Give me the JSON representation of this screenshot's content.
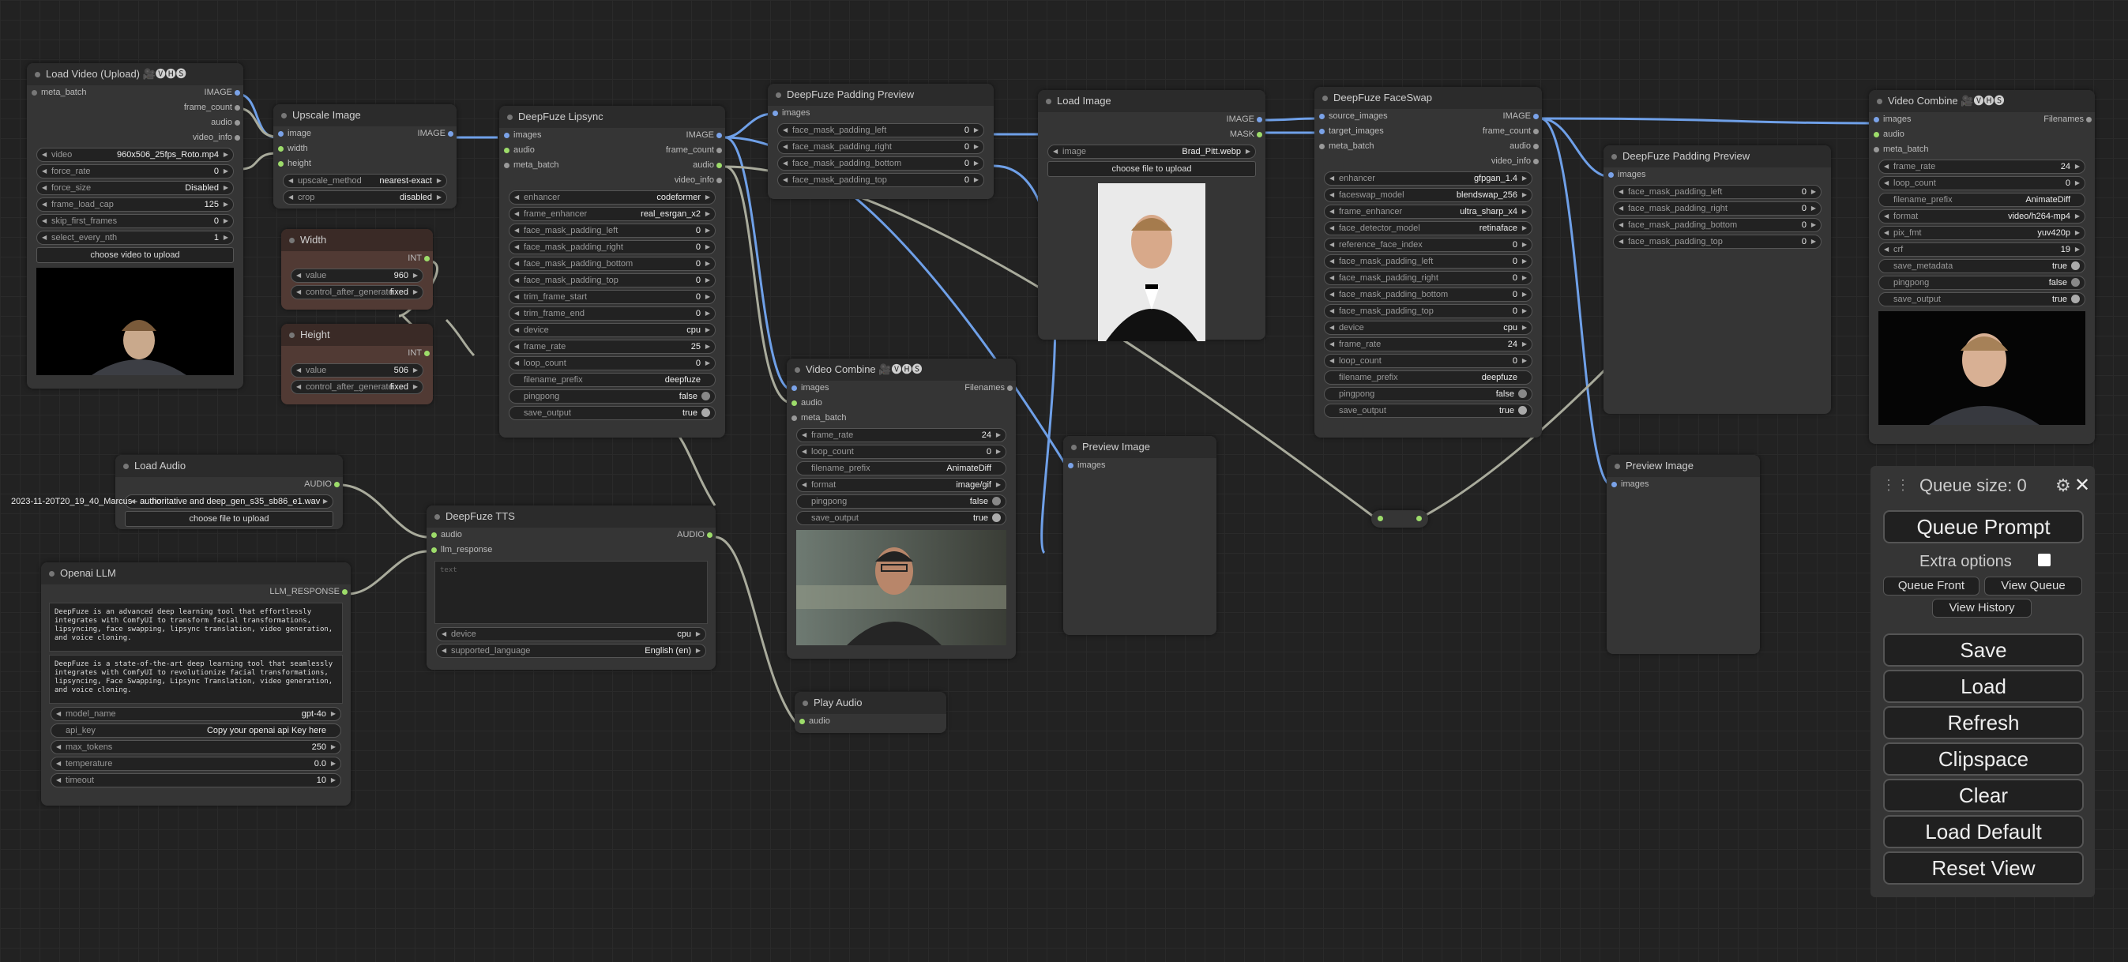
{
  "app": {
    "name": "ComfyUI"
  },
  "nodes": {
    "load_video": {
      "title": "Load Video (Upload) 🎥🅥🅗🅢",
      "inputs": [
        "meta_batch"
      ],
      "outputs": [
        "IMAGE",
        "frame_count",
        "audio",
        "video_info"
      ],
      "widgets": [
        {
          "label": "video",
          "value": "960x506_25fps_Roto.mp4"
        },
        {
          "label": "force_rate",
          "value": "0"
        },
        {
          "label": "force_size",
          "value": "Disabled"
        },
        {
          "label": "frame_load_cap",
          "value": "125"
        },
        {
          "label": "skip_first_frames",
          "value": "0"
        },
        {
          "label": "select_every_nth",
          "value": "1"
        }
      ],
      "upload_label": "choose video to upload"
    },
    "upscale_image": {
      "title": "Upscale Image",
      "inputs": [
        "image",
        "width",
        "height"
      ],
      "outputs": [
        "IMAGE"
      ],
      "widgets": [
        {
          "label": "upscale_method",
          "value": "nearest-exact"
        },
        {
          "label": "crop",
          "value": "disabled"
        }
      ]
    },
    "width": {
      "title": "Width",
      "output": "INT",
      "widgets": [
        {
          "label": "value",
          "value": "960"
        },
        {
          "label": "control_after_generate",
          "value": "fixed"
        }
      ]
    },
    "height": {
      "title": "Height",
      "output": "INT",
      "widgets": [
        {
          "label": "value",
          "value": "506"
        },
        {
          "label": "control_after_generate",
          "value": "fixed"
        }
      ]
    },
    "lipsync": {
      "title": "DeepFuze Lipsync",
      "inputs": [
        "images",
        "audio",
        "meta_batch"
      ],
      "outputs": [
        "IMAGE",
        "frame_count",
        "audio",
        "video_info"
      ],
      "widgets": [
        {
          "label": "enhancer",
          "value": "codeformer"
        },
        {
          "label": "frame_enhancer",
          "value": "real_esrgan_x2"
        },
        {
          "label": "face_mask_padding_left",
          "value": "0"
        },
        {
          "label": "face_mask_padding_right",
          "value": "0"
        },
        {
          "label": "face_mask_padding_bottom",
          "value": "0"
        },
        {
          "label": "face_mask_padding_top",
          "value": "0"
        },
        {
          "label": "trim_frame_start",
          "value": "0"
        },
        {
          "label": "trim_frame_end",
          "value": "0"
        },
        {
          "label": "device",
          "value": "cpu"
        },
        {
          "label": "frame_rate",
          "value": "25"
        },
        {
          "label": "loop_count",
          "value": "0"
        }
      ],
      "text_widgets": [
        {
          "label": "filename_prefix",
          "value": "deepfuze"
        }
      ],
      "toggles": [
        {
          "label": "pingpong",
          "value": "false"
        },
        {
          "label": "save_output",
          "value": "true"
        }
      ]
    },
    "padding_preview1": {
      "title": "DeepFuze Padding Preview",
      "inputs": [
        "images"
      ],
      "widgets": [
        {
          "label": "face_mask_padding_left",
          "value": "0"
        },
        {
          "label": "face_mask_padding_right",
          "value": "0"
        },
        {
          "label": "face_mask_padding_bottom",
          "value": "0"
        },
        {
          "label": "face_mask_padding_top",
          "value": "0"
        }
      ]
    },
    "load_image": {
      "title": "Load Image",
      "outputs": [
        "IMAGE",
        "MASK"
      ],
      "widgets": [
        {
          "label": "image",
          "value": "Brad_Pitt.webp"
        }
      ],
      "upload_label": "choose file to upload"
    },
    "faceswap": {
      "title": "DeepFuze FaceSwap",
      "inputs": [
        "source_images",
        "target_images",
        "meta_batch"
      ],
      "outputs": [
        "IMAGE",
        "frame_count",
        "audio",
        "video_info"
      ],
      "widgets": [
        {
          "label": "enhancer",
          "value": "gfpgan_1.4"
        },
        {
          "label": "faceswap_model",
          "value": "blendswap_256"
        },
        {
          "label": "frame_enhancer",
          "value": "ultra_sharp_x4"
        },
        {
          "label": "face_detector_model",
          "value": "retinaface"
        },
        {
          "label": "reference_face_index",
          "value": "0"
        },
        {
          "label": "face_mask_padding_left",
          "value": "0"
        },
        {
          "label": "face_mask_padding_right",
          "value": "0"
        },
        {
          "label": "face_mask_padding_bottom",
          "value": "0"
        },
        {
          "label": "face_mask_padding_top",
          "value": "0"
        },
        {
          "label": "device",
          "value": "cpu"
        },
        {
          "label": "frame_rate",
          "value": "24"
        },
        {
          "label": "loop_count",
          "value": "0"
        }
      ],
      "text_widgets": [
        {
          "label": "filename_prefix",
          "value": "deepfuze"
        }
      ],
      "toggles": [
        {
          "label": "pingpong",
          "value": "false"
        },
        {
          "label": "save_output",
          "value": "true"
        }
      ]
    },
    "padding_preview2": {
      "title": "DeepFuze Padding Preview",
      "inputs": [
        "images"
      ],
      "widgets": [
        {
          "label": "face_mask_padding_left",
          "value": "0"
        },
        {
          "label": "face_mask_padding_right",
          "value": "0"
        },
        {
          "label": "face_mask_padding_bottom",
          "value": "0"
        },
        {
          "label": "face_mask_padding_top",
          "value": "0"
        }
      ]
    },
    "video_combine1": {
      "title": "Video Combine 🎥🅥🅗🅢",
      "inputs": [
        "images",
        "audio",
        "meta_batch"
      ],
      "outputs": [
        "Filenames"
      ],
      "widgets": [
        {
          "label": "frame_rate",
          "value": "24"
        },
        {
          "label": "loop_count",
          "value": "0"
        },
        {
          "label": "format",
          "value": "image/gif"
        }
      ],
      "text_widgets": [
        {
          "label": "filename_prefix",
          "value": "AnimateDiff"
        }
      ],
      "toggles": [
        {
          "label": "pingpong",
          "value": "false"
        },
        {
          "label": "save_output",
          "value": "true"
        }
      ]
    },
    "video_combine2": {
      "title": "Video Combine 🎥🅥🅗🅢",
      "inputs": [
        "images",
        "audio",
        "meta_batch"
      ],
      "outputs": [
        "Filenames"
      ],
      "widgets": [
        {
          "label": "frame_rate",
          "value": "24"
        },
        {
          "label": "loop_count",
          "value": "0"
        },
        {
          "label": "format",
          "value": "video/h264-mp4"
        },
        {
          "label": "pix_fmt",
          "value": "yuv420p"
        },
        {
          "label": "crf",
          "value": "19"
        }
      ],
      "text_widgets": [
        {
          "label": "filename_prefix",
          "value": "AnimateDiff"
        }
      ],
      "toggles": [
        {
          "label": "save_metadata",
          "value": "true"
        },
        {
          "label": "pingpong",
          "value": "false"
        },
        {
          "label": "save_output",
          "value": "true"
        }
      ]
    },
    "preview1": {
      "title": "Preview Image",
      "inputs": [
        "images"
      ]
    },
    "preview2": {
      "title": "Preview Image",
      "inputs": [
        "images"
      ]
    },
    "load_audio": {
      "title": "Load Audio",
      "outputs": [
        "AUDIO"
      ],
      "widgets": [
        {
          "label": "audio",
          "value": "2023-11-20T20_19_40_Marcus - authoritative and deep_gen_s35_sb86_e1.wav"
        }
      ],
      "upload_label": "choose file to upload"
    },
    "tts": {
      "title": "DeepFuze TTS",
      "inputs": [
        "audio",
        "llm_response"
      ],
      "outputs": [
        "AUDIO"
      ],
      "placeholder": "text",
      "widgets": [
        {
          "label": "device",
          "value": "cpu"
        },
        {
          "label": "supported_language",
          "value": "English (en)"
        }
      ]
    },
    "openai": {
      "title": "Openai LLM",
      "outputs": [
        "LLM_RESPONSE"
      ],
      "text1": "DeepFuze is an advanced deep learning tool that effortlessly integrates with ComfyUI to transform facial transformations, lipsyncing, face swapping, lipsync translation, video generation, and voice cloning.",
      "text2": "DeepFuze is a state-of-the-art deep learning tool that seamlessly integrates with ComfyUI to revolutionize facial transformations, lipsyncing, Face Swapping, Lipsync Translation, video generation, and voice cloning.",
      "widgets": [
        {
          "label": "model_name",
          "value": "gpt-4o"
        },
        {
          "label": "api_key",
          "value": "Copy your openai api Key here"
        },
        {
          "label": "max_tokens",
          "value": "250"
        },
        {
          "label": "temperature",
          "value": "0.0"
        },
        {
          "label": "timeout",
          "value": "10"
        }
      ]
    },
    "play_audio": {
      "title": "Play Audio",
      "inputs": [
        "audio"
      ]
    }
  },
  "queue_panel": {
    "queue_size": "Queue size: 0",
    "queue_prompt": "Queue Prompt",
    "extra_options": "Extra options",
    "queue_front": "Queue Front",
    "view_queue": "View Queue",
    "view_history": "View History",
    "buttons": [
      "Save",
      "Load",
      "Refresh",
      "Clipspace",
      "Clear",
      "Load Default",
      "Reset View"
    ]
  },
  "colors": {
    "image_link": "#6fa0e8",
    "other_link": "#a9ab9c",
    "int_node": "#513a34"
  }
}
